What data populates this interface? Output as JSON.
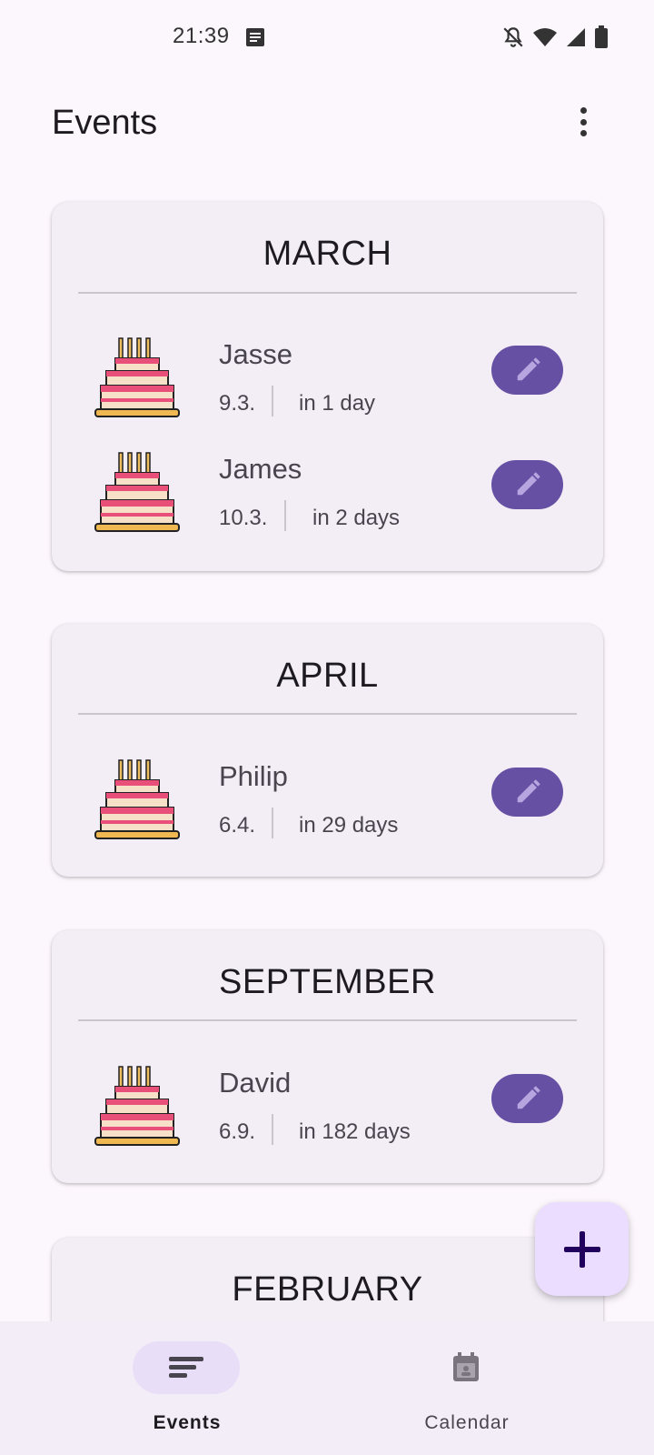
{
  "status_bar": {
    "time": "21:39",
    "icons": [
      "note-icon",
      "bell-off-icon",
      "wifi-icon",
      "signal-icon",
      "battery-icon"
    ]
  },
  "header": {
    "title": "Events",
    "menu_icon": "more-vert-icon"
  },
  "months": [
    {
      "title": "MARCH",
      "events": [
        {
          "name": "Jasse",
          "date": "9.3.",
          "relative": "in 1 day"
        },
        {
          "name": "James",
          "date": "10.3.",
          "relative": "in 2 days"
        }
      ]
    },
    {
      "title": "APRIL",
      "events": [
        {
          "name": "Philip",
          "date": "6.4.",
          "relative": "in 29 days"
        }
      ]
    },
    {
      "title": "SEPTEMBER",
      "events": [
        {
          "name": "David",
          "date": "6.9.",
          "relative": "in 182 days"
        }
      ]
    },
    {
      "title": "FEBRUARY",
      "events": []
    }
  ],
  "fab": {
    "icon": "plus-icon"
  },
  "bottom_nav": {
    "items": [
      {
        "label": "Events",
        "icon": "events-list-icon",
        "active": true
      },
      {
        "label": "Calendar",
        "icon": "calendar-icon",
        "active": false
      }
    ]
  },
  "colors": {
    "background": "#fcf7fd",
    "card": "#f3edf6",
    "accent": "#6650a4",
    "fab": "#eaddff",
    "nav_indicator": "#e8def8"
  }
}
